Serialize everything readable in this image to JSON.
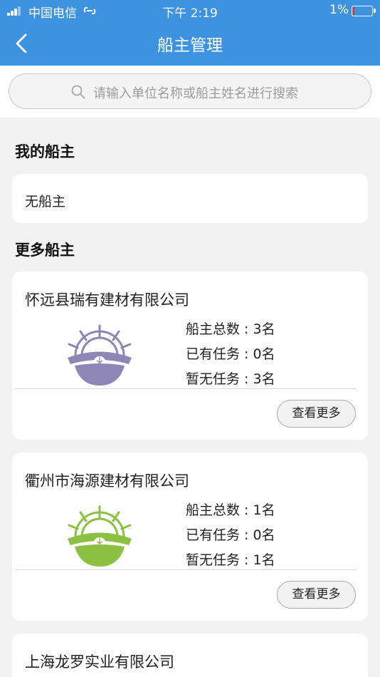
{
  "status_bar": {
    "carrier": "中国电信",
    "time": "下午 2:19",
    "battery": "1%"
  },
  "header": {
    "title": "船主管理",
    "back_icon": "chevron-left-icon"
  },
  "search": {
    "placeholder": "请输入单位名称或船主姓名进行搜索",
    "icon": "search-icon"
  },
  "my_owners": {
    "title": "我的船主",
    "empty_text": "无船主"
  },
  "more_owners": {
    "title": "更多船主",
    "companies": [
      {
        "name": "怀远县瑞有建材有限公司",
        "logo_color": "#8e87b6",
        "total": "船主总数 : 3名",
        "with_task": "已有任务 : 0名",
        "no_task": "暂无任务 : 3名",
        "button": "查看更多"
      },
      {
        "name": "衢州市海源建材有限公司",
        "logo_color": "#8cc043",
        "total": "船主总数 : 1名",
        "with_task": "已有任务 : 0名",
        "no_task": "暂无任务 : 1名",
        "button": "查看更多"
      },
      {
        "name": "上海龙罗实业有限公司"
      }
    ]
  },
  "colors": {
    "header_bg": "#3d93e0",
    "page_bg": "#f2f2f2"
  }
}
